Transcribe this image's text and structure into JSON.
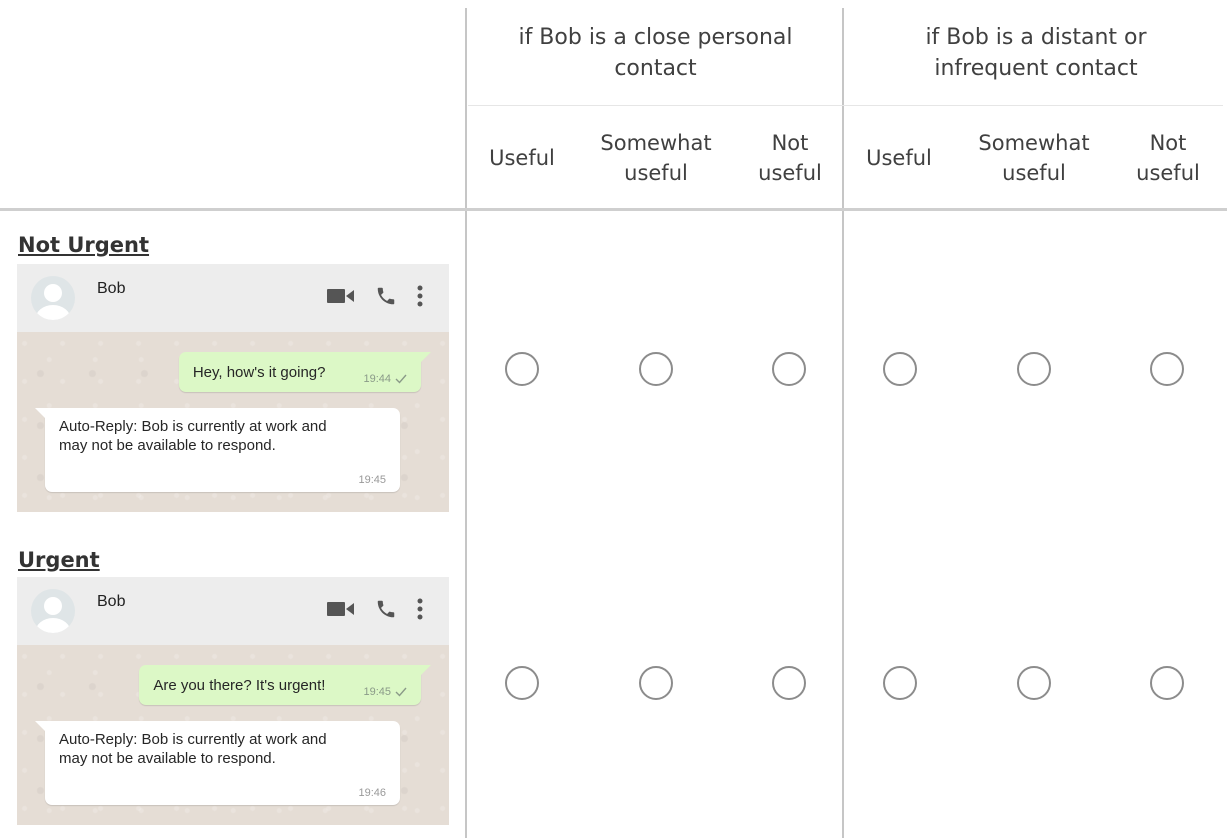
{
  "groups": [
    {
      "label": "if Bob is a close personal contact"
    },
    {
      "label": "if Bob is a distant or infrequent contact"
    }
  ],
  "columns": [
    "Useful",
    "Somewhat useful",
    "Not useful",
    "Useful",
    "Somewhat useful",
    "Not useful"
  ],
  "rows": [
    {
      "label": "Not Urgent",
      "chat": {
        "contact": "Bob",
        "outgoing": {
          "text": "Hey, how's it going?",
          "time": "19:44"
        },
        "incoming": {
          "text": "Auto-Reply: Bob is currently at work and may not be available to respond.",
          "time": "19:45"
        }
      }
    },
    {
      "label": "Urgent",
      "chat": {
        "contact": "Bob",
        "outgoing": {
          "text": "Are you there? It's urgent!",
          "time": "19:45"
        },
        "incoming": {
          "text": "Auto-Reply: Bob is currently at work and may not be available to respond.",
          "time": "19:46"
        }
      }
    }
  ],
  "icons": {
    "header": [
      "video-camera-icon",
      "phone-icon",
      "more-vertical-icon"
    ],
    "sent_status": "check-icon",
    "avatar": "user-avatar-icon"
  },
  "colors": {
    "outgoing_bubble": "#dcf8c6",
    "chat_background": "#e5ddd5",
    "chat_header": "#ededed",
    "radio_border": "#8c8c8c"
  }
}
